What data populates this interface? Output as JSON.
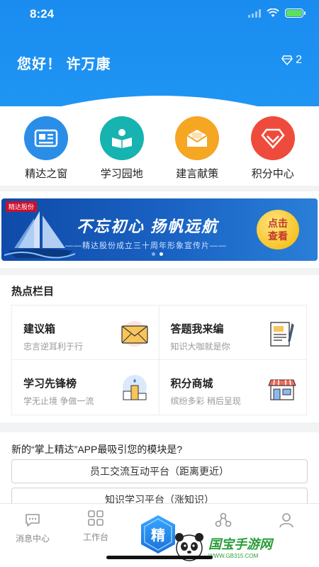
{
  "status_bar": {
    "time": "8:24"
  },
  "header": {
    "greeting": "您好！ 许万康",
    "points": "2"
  },
  "quick_menu": [
    {
      "label": "精达之窗",
      "icon": "newspaper-icon",
      "color": "#2a8de8"
    },
    {
      "label": "学习园地",
      "icon": "reading-icon",
      "color": "#16b3b0"
    },
    {
      "label": "建言献策",
      "icon": "mail-icon",
      "color": "#f5a623"
    },
    {
      "label": "积分中心",
      "icon": "diamond-icon",
      "color": "#ef4b3c"
    }
  ],
  "banner": {
    "logo": "精达股份",
    "title": "不忘初心 扬帆远航",
    "subtitle": "——精达股份成立三十周年形象宣传片——",
    "button_line1": "点击",
    "button_line2": "查看"
  },
  "hot": {
    "title": "热点栏目",
    "items": [
      {
        "name": "建议箱",
        "desc": "忠言逆耳利于行",
        "icon": "envelope-icon"
      },
      {
        "name": "答题我来编",
        "desc": "知识大咖就是你",
        "icon": "quiz-paper-icon"
      },
      {
        "name": "学习先锋榜",
        "desc": "学无止境 争做一流",
        "icon": "podium-icon"
      },
      {
        "name": "积分商城",
        "desc": "缤纷多彩 稍后呈现",
        "icon": "store-icon"
      }
    ]
  },
  "survey": {
    "question": "新的“掌上精达”APP最吸引您的模块是?",
    "options": [
      "员工交流互动平台（距离更近）",
      "知识学习平台（涨知识）"
    ]
  },
  "tabbar": {
    "items": [
      {
        "label": "消息中心",
        "icon": "chat-icon"
      },
      {
        "label": "工作台",
        "icon": "grid-icon"
      },
      {
        "label": "精",
        "icon": "hexagon-logo-icon"
      },
      {
        "label": "",
        "icon": "network-icon"
      },
      {
        "label": "",
        "icon": "user-icon"
      }
    ]
  },
  "watermark": {
    "text": "国宝手游网",
    "url": "WWW.GB315.COM"
  }
}
